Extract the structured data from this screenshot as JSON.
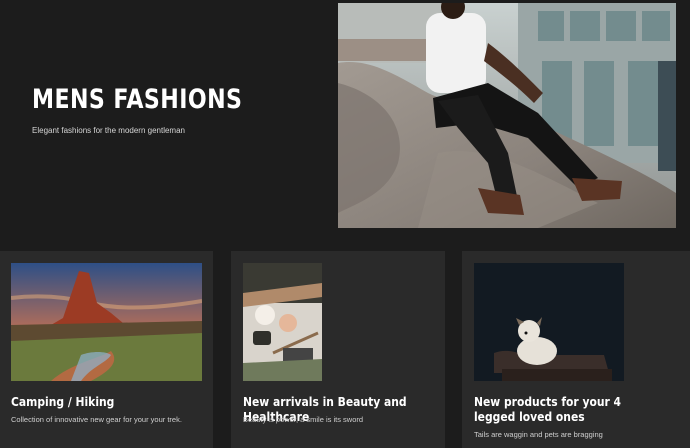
{
  "hero": {
    "title": "MENS FASHIONS",
    "subtitle": "Elegant fashions for the modern gentleman"
  },
  "cards": [
    {
      "title": "Camping / Hiking",
      "description": "Collection of innovative new gear for your your trek."
    },
    {
      "title": "New arrivals in Beauty and Healthcare",
      "description": "Beauty is power, a smile is its sword"
    },
    {
      "title": "New products for your 4 legged loved ones",
      "description": "Tails are waggin and pets are bragging"
    }
  ],
  "colors": {
    "background": "#1c1c1c",
    "card_background": "#2a2a2a",
    "text": "#ffffff"
  }
}
